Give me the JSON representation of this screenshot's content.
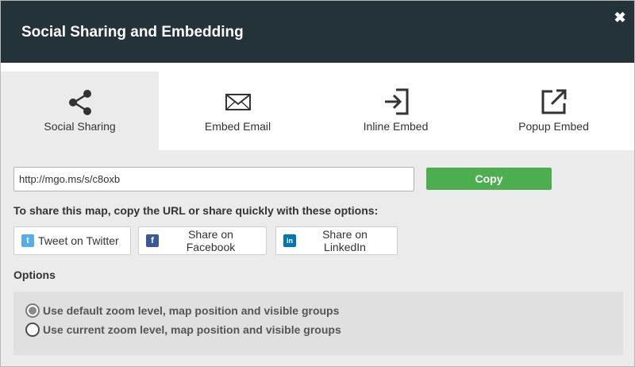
{
  "dialog": {
    "title": "Social Sharing and Embedding",
    "close_icon": "close-icon",
    "close_glyph": "✖"
  },
  "tabs": [
    {
      "label": "Social Sharing",
      "icon": "share-icon",
      "active": true
    },
    {
      "label": "Embed Email",
      "icon": "envelope-icon",
      "active": false
    },
    {
      "label": "Inline Embed",
      "icon": "sign-in-icon",
      "active": false
    },
    {
      "label": "Popup Embed",
      "icon": "external-link-icon",
      "active": false
    }
  ],
  "url": {
    "value": "http://mgo.ms/s/c8oxb"
  },
  "copy_button": {
    "label": "Copy",
    "color": "#4cae4f"
  },
  "share": {
    "instructions": "To share this map, copy the URL or share quickly with these options:",
    "buttons": [
      {
        "label": "Tweet on Twitter",
        "icon": "twitter-icon",
        "glyph": "t",
        "color": "#55acee"
      },
      {
        "label": "Share on Facebook",
        "icon": "facebook-icon",
        "glyph": "f",
        "color": "#3b5998"
      },
      {
        "label": "Share on LinkedIn",
        "icon": "linkedin-icon",
        "glyph": "in",
        "color": "#0077b5"
      }
    ]
  },
  "options": {
    "label": "Options",
    "radios": [
      {
        "label": "Use default zoom level, map position and visible groups",
        "checked": true
      },
      {
        "label": "Use current zoom level, map position and visible groups",
        "checked": false
      }
    ]
  },
  "colors": {
    "header_bg": "#24323a",
    "body_bg": "#ebebeb",
    "accent_green": "#4cae4f"
  }
}
